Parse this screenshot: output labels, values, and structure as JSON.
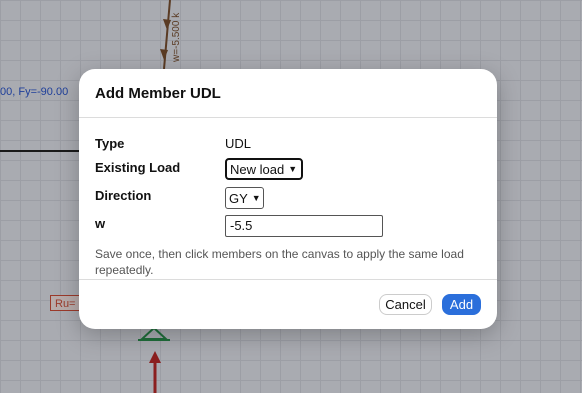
{
  "canvas": {
    "reaction_text": "00, Fy=-90.00",
    "udl_text": "w=-5.500 k",
    "ru_text": "Ru="
  },
  "dialog": {
    "title": "Add Member UDL",
    "type_label": "Type",
    "type_value": "UDL",
    "existing_load_label": "Existing Load",
    "existing_load_value": "New load",
    "direction_label": "Direction",
    "direction_value": "GY",
    "w_label": "w",
    "w_value": "-5.5",
    "hint": "Save once, then click members on the canvas to apply the same load repeatedly.",
    "cancel_label": "Cancel",
    "add_label": "Add"
  },
  "colors": {
    "accent": "#2b6fdb",
    "member": "#1a1a1a",
    "udl": "#5a3b24",
    "support": "#1f6e3a",
    "reaction_arrow": "#8b1f1f"
  }
}
